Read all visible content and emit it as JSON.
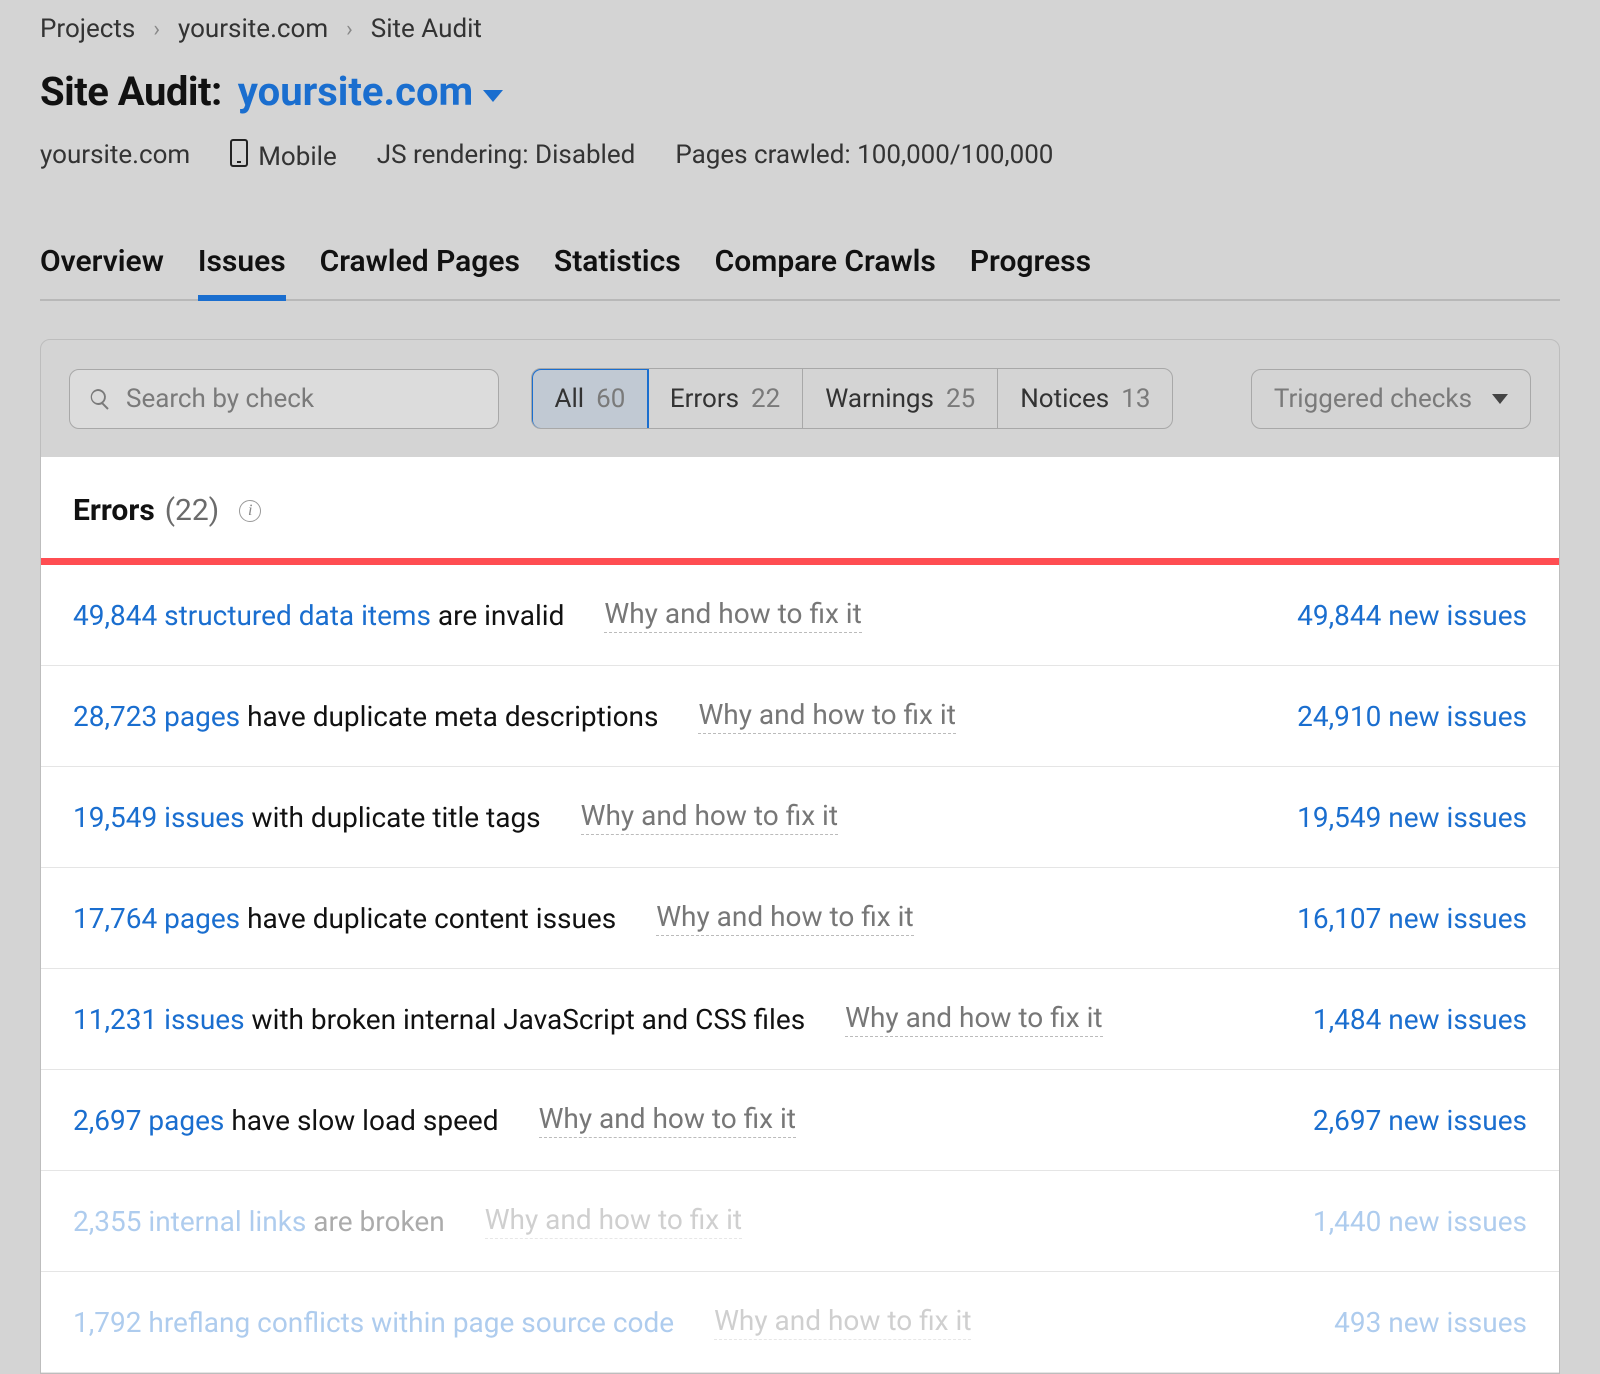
{
  "breadcrumb": {
    "items": [
      "Projects",
      "yoursite.com",
      "Site Audit"
    ]
  },
  "header": {
    "title_label": "Site Audit:",
    "site": "yoursite.com"
  },
  "meta": {
    "domain": "yoursite.com",
    "mobile_label": "Mobile",
    "js_rendering": "JS rendering: Disabled",
    "pages_crawled": "Pages crawled: 100,000/100,000"
  },
  "tabs": [
    "Overview",
    "Issues",
    "Crawled Pages",
    "Statistics",
    "Compare Crawls",
    "Progress"
  ],
  "toolbar": {
    "search_placeholder": "Search by check",
    "filters": [
      {
        "label": "All",
        "count": "60"
      },
      {
        "label": "Errors",
        "count": "22"
      },
      {
        "label": "Warnings",
        "count": "25"
      },
      {
        "label": "Notices",
        "count": "13"
      }
    ],
    "triggered_label": "Triggered checks"
  },
  "section": {
    "title": "Errors",
    "count": "(22)"
  },
  "howfix_label": "Why and how to fix it",
  "new_issues_suffix": "new issues",
  "issues": [
    {
      "count": "49,844",
      "unit": "structured data items",
      "rest": " are invalid",
      "new": "49,844"
    },
    {
      "count": "28,723",
      "unit": "pages",
      "rest": " have duplicate meta descriptions",
      "new": "24,910"
    },
    {
      "count": "19,549",
      "unit": "issues",
      "rest": " with duplicate title tags",
      "new": "19,549"
    },
    {
      "count": "17,764",
      "unit": "pages",
      "rest": " have duplicate content issues",
      "new": "16,107"
    },
    {
      "count": "11,231",
      "unit": "issues",
      "rest": " with broken internal JavaScript and CSS files",
      "new": "1,484"
    },
    {
      "count": "2,697",
      "unit": "pages",
      "rest": " have slow load speed",
      "new": "2,697"
    },
    {
      "count": "2,355",
      "unit": "internal links",
      "rest": " are broken",
      "new": "1,440"
    },
    {
      "count": "1,792",
      "unit": "hreflang conflicts within page source code",
      "rest": "",
      "new": "493"
    }
  ]
}
